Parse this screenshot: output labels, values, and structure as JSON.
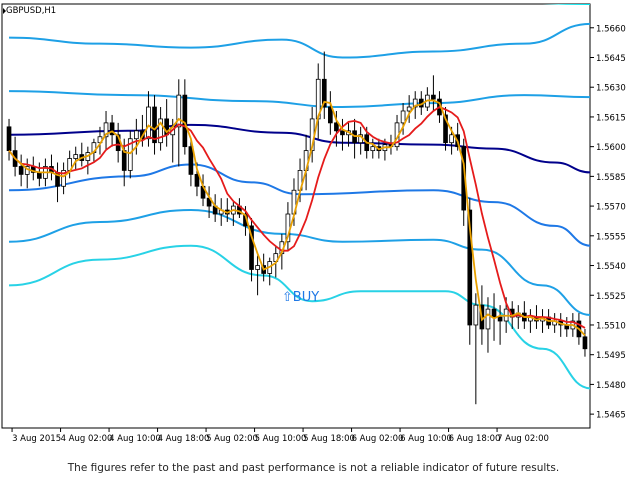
{
  "chart_data": {
    "type": "candlestick",
    "title": "GBPUSD,H1",
    "ylim": [
      1.5458,
      1.5672
    ],
    "y_ticks": [
      "1.5660",
      "1.5645",
      "1.5630",
      "1.5615",
      "1.5600",
      "1.5585",
      "1.5570",
      "1.5555",
      "1.5540",
      "1.5525",
      "1.5510",
      "1.5495",
      "1.5480",
      "1.5465"
    ],
    "x_ticks": [
      "3 Aug 2015",
      "4 Aug 02:00",
      "4 Aug 10:00",
      "4 Aug 18:00",
      "5 Aug 02:00",
      "5 Aug 10:00",
      "5 Aug 18:00",
      "6 Aug 02:00",
      "6 Aug 10:00",
      "6 Aug 18:00",
      "7 Aug 02:00"
    ],
    "n_bars": 96,
    "candles": [
      [
        1.561,
        1.5614,
        1.5593,
        1.5598
      ],
      [
        1.5598,
        1.5605,
        1.5585,
        1.559
      ],
      [
        1.559,
        1.5596,
        1.558,
        1.5586
      ],
      [
        1.5586,
        1.5594,
        1.5579,
        1.559
      ],
      [
        1.559,
        1.5595,
        1.5583,
        1.5587
      ],
      [
        1.5587,
        1.5592,
        1.558,
        1.5584
      ],
      [
        1.5584,
        1.5594,
        1.558,
        1.559
      ],
      [
        1.559,
        1.5596,
        1.5583,
        1.5587
      ],
      [
        1.5587,
        1.5592,
        1.5572,
        1.558
      ],
      [
        1.558,
        1.5592,
        1.5576,
        1.5588
      ],
      [
        1.5588,
        1.5598,
        1.5584,
        1.5594
      ],
      [
        1.5594,
        1.56,
        1.5588,
        1.5596
      ],
      [
        1.5596,
        1.5602,
        1.559,
        1.5593
      ],
      [
        1.5593,
        1.56,
        1.5586,
        1.5597
      ],
      [
        1.5597,
        1.5604,
        1.5592,
        1.5602
      ],
      [
        1.5602,
        1.561,
        1.5596,
        1.5605
      ],
      [
        1.5605,
        1.5618,
        1.5598,
        1.5612
      ],
      [
        1.5612,
        1.5616,
        1.56,
        1.5606
      ],
      [
        1.5606,
        1.5612,
        1.5592,
        1.5598
      ],
      [
        1.5598,
        1.5604,
        1.558,
        1.5588
      ],
      [
        1.5588,
        1.5608,
        1.5584,
        1.5604
      ],
      [
        1.5604,
        1.5614,
        1.5596,
        1.5608
      ],
      [
        1.5608,
        1.5616,
        1.56,
        1.5604
      ],
      [
        1.5604,
        1.5628,
        1.56,
        1.562
      ],
      [
        1.562,
        1.5626,
        1.5596,
        1.5602
      ],
      [
        1.5602,
        1.562,
        1.5598,
        1.5614
      ],
      [
        1.5614,
        1.5624,
        1.56,
        1.5606
      ],
      [
        1.5606,
        1.5614,
        1.5592,
        1.561
      ],
      [
        1.561,
        1.5634,
        1.559,
        1.5626
      ],
      [
        1.5626,
        1.5634,
        1.5596,
        1.56
      ],
      [
        1.56,
        1.5604,
        1.558,
        1.5586
      ],
      [
        1.5586,
        1.5592,
        1.5575,
        1.558
      ],
      [
        1.558,
        1.5586,
        1.557,
        1.5574
      ],
      [
        1.5574,
        1.558,
        1.5564,
        1.557
      ],
      [
        1.557,
        1.5576,
        1.5562,
        1.5566
      ],
      [
        1.5566,
        1.5574,
        1.556,
        1.5568
      ],
      [
        1.5568,
        1.5574,
        1.5562,
        1.5566
      ],
      [
        1.5566,
        1.5572,
        1.556,
        1.557
      ],
      [
        1.557,
        1.5574,
        1.5564,
        1.5566
      ],
      [
        1.5566,
        1.557,
        1.5555,
        1.556
      ],
      [
        1.556,
        1.5564,
        1.5532,
        1.5538
      ],
      [
        1.5538,
        1.5545,
        1.5525,
        1.554
      ],
      [
        1.554,
        1.5546,
        1.5532,
        1.5536
      ],
      [
        1.5536,
        1.5544,
        1.553,
        1.5542
      ],
      [
        1.5542,
        1.555,
        1.5534,
        1.5546
      ],
      [
        1.5546,
        1.5556,
        1.5538,
        1.5552
      ],
      [
        1.5552,
        1.5572,
        1.5548,
        1.5566
      ],
      [
        1.5566,
        1.5584,
        1.556,
        1.5578
      ],
      [
        1.5578,
        1.5594,
        1.5572,
        1.5588
      ],
      [
        1.5588,
        1.5606,
        1.5578,
        1.5598
      ],
      [
        1.5598,
        1.562,
        1.5592,
        1.5614
      ],
      [
        1.5614,
        1.5642,
        1.5604,
        1.5634
      ],
      [
        1.5634,
        1.5648,
        1.5614,
        1.562
      ],
      [
        1.562,
        1.5628,
        1.5606,
        1.5612
      ],
      [
        1.5612,
        1.5618,
        1.56,
        1.5608
      ],
      [
        1.5608,
        1.5614,
        1.5598,
        1.5606
      ],
      [
        1.5606,
        1.5612,
        1.56,
        1.5608
      ],
      [
        1.5608,
        1.5614,
        1.5594,
        1.5602
      ],
      [
        1.5602,
        1.561,
        1.5596,
        1.5606
      ],
      [
        1.5606,
        1.561,
        1.5594,
        1.5598
      ],
      [
        1.5598,
        1.5604,
        1.5594,
        1.56
      ],
      [
        1.56,
        1.5604,
        1.5594,
        1.5598
      ],
      [
        1.5598,
        1.5604,
        1.5593,
        1.5601
      ],
      [
        1.5601,
        1.5606,
        1.5596,
        1.56
      ],
      [
        1.56,
        1.5616,
        1.5598,
        1.5612
      ],
      [
        1.5612,
        1.5622,
        1.5606,
        1.5618
      ],
      [
        1.5618,
        1.5626,
        1.5612,
        1.562
      ],
      [
        1.562,
        1.5628,
        1.5614,
        1.5624
      ],
      [
        1.5624,
        1.5628,
        1.5616,
        1.562
      ],
      [
        1.562,
        1.563,
        1.5618,
        1.5626
      ],
      [
        1.5626,
        1.5636,
        1.5618,
        1.5624
      ],
      [
        1.5624,
        1.5628,
        1.5612,
        1.5616
      ],
      [
        1.5616,
        1.562,
        1.5598,
        1.5602
      ],
      [
        1.5602,
        1.561,
        1.5596,
        1.5606
      ],
      [
        1.5606,
        1.5612,
        1.5598,
        1.56
      ],
      [
        1.56,
        1.5604,
        1.556,
        1.5568
      ],
      [
        1.5568,
        1.5574,
        1.55,
        1.551
      ],
      [
        1.551,
        1.5526,
        1.547,
        1.552
      ],
      [
        1.552,
        1.553,
        1.55,
        1.5508
      ],
      [
        1.5508,
        1.5524,
        1.5496,
        1.5518
      ],
      [
        1.5518,
        1.5526,
        1.5502,
        1.5514
      ],
      [
        1.5514,
        1.552,
        1.55,
        1.5512
      ],
      [
        1.5512,
        1.5524,
        1.5506,
        1.5518
      ],
      [
        1.5518,
        1.5522,
        1.5508,
        1.5514
      ],
      [
        1.5514,
        1.552,
        1.5508,
        1.5516
      ],
      [
        1.5516,
        1.5522,
        1.5508,
        1.5512
      ],
      [
        1.5512,
        1.5518,
        1.5506,
        1.5514
      ],
      [
        1.5514,
        1.552,
        1.5508,
        1.5512
      ],
      [
        1.5512,
        1.5518,
        1.5506,
        1.5514
      ],
      [
        1.5514,
        1.5518,
        1.5508,
        1.551
      ],
      [
        1.551,
        1.5516,
        1.5506,
        1.5512
      ],
      [
        1.5512,
        1.5516,
        1.5504,
        1.551
      ],
      [
        1.551,
        1.5514,
        1.5504,
        1.5508
      ],
      [
        1.5508,
        1.5516,
        1.5504,
        1.5512
      ],
      [
        1.5512,
        1.5516,
        1.55,
        1.5504
      ],
      [
        1.5504,
        1.5508,
        1.5494,
        1.5498
      ]
    ],
    "lines": [
      {
        "color": "#00e5ee",
        "points": [
          [
            0,
            1.5675
          ],
          [
            20,
            1.5676
          ],
          [
            40,
            1.5674
          ],
          [
            60,
            1.5676
          ],
          [
            80,
            1.5673
          ],
          [
            96,
            1.5672
          ]
        ]
      },
      {
        "color": "#1ea0e6",
        "points": [
          [
            0,
            1.5655
          ],
          [
            15,
            1.5652
          ],
          [
            30,
            1.565
          ],
          [
            45,
            1.5654
          ],
          [
            55,
            1.5645
          ],
          [
            70,
            1.5648
          ],
          [
            85,
            1.5652
          ],
          [
            96,
            1.5662
          ]
        ]
      },
      {
        "color": "#1ea0e6",
        "points": [
          [
            0,
            1.5628
          ],
          [
            20,
            1.5626
          ],
          [
            40,
            1.5623
          ],
          [
            55,
            1.562
          ],
          [
            70,
            1.5622
          ],
          [
            85,
            1.5626
          ],
          [
            96,
            1.5625
          ]
        ]
      },
      {
        "color": "#00008b",
        "points": [
          [
            0,
            1.5606
          ],
          [
            20,
            1.5608
          ],
          [
            30,
            1.5611
          ],
          [
            45,
            1.5607
          ],
          [
            55,
            1.5602
          ],
          [
            70,
            1.5601
          ],
          [
            80,
            1.5599
          ],
          [
            90,
            1.5592
          ],
          [
            96,
            1.5587
          ]
        ]
      },
      {
        "color": "#1e78e6",
        "points": [
          [
            0,
            1.5578
          ],
          [
            20,
            1.5585
          ],
          [
            30,
            1.5591
          ],
          [
            40,
            1.5582
          ],
          [
            48,
            1.5576
          ],
          [
            70,
            1.5578
          ],
          [
            80,
            1.5572
          ],
          [
            90,
            1.556
          ],
          [
            96,
            1.555
          ]
        ]
      },
      {
        "color": "#1ea0e6",
        "points": [
          [
            0,
            1.5552
          ],
          [
            15,
            1.5562
          ],
          [
            30,
            1.5568
          ],
          [
            45,
            1.5556
          ],
          [
            55,
            1.5552
          ],
          [
            70,
            1.5553
          ],
          [
            78,
            1.5548
          ],
          [
            88,
            1.553
          ],
          [
            96,
            1.5515
          ]
        ]
      },
      {
        "color": "#28d2e6",
        "points": [
          [
            0,
            1.553
          ],
          [
            15,
            1.5543
          ],
          [
            30,
            1.555
          ],
          [
            42,
            1.5535
          ],
          [
            50,
            1.5522
          ],
          [
            58,
            1.5527
          ],
          [
            72,
            1.5527
          ],
          [
            78,
            1.552
          ],
          [
            88,
            1.5498
          ],
          [
            96,
            1.5478
          ]
        ]
      }
    ],
    "mas": [
      {
        "color": "#e51b1b",
        "period": 8
      },
      {
        "color": "#e8a000",
        "period": 3
      }
    ],
    "annotation": {
      "text": "BUY",
      "arrow": "⇧",
      "bar": 46
    },
    "colors": {
      "bull": "#ffffff",
      "bear": "#000000",
      "grid": "#d4d4d4",
      "axis": "#000000",
      "annotation": "#1e78e6"
    }
  },
  "footer": {
    "disclaimer": "The figures refer to the past and past performance is not a reliable indicator of future results."
  }
}
